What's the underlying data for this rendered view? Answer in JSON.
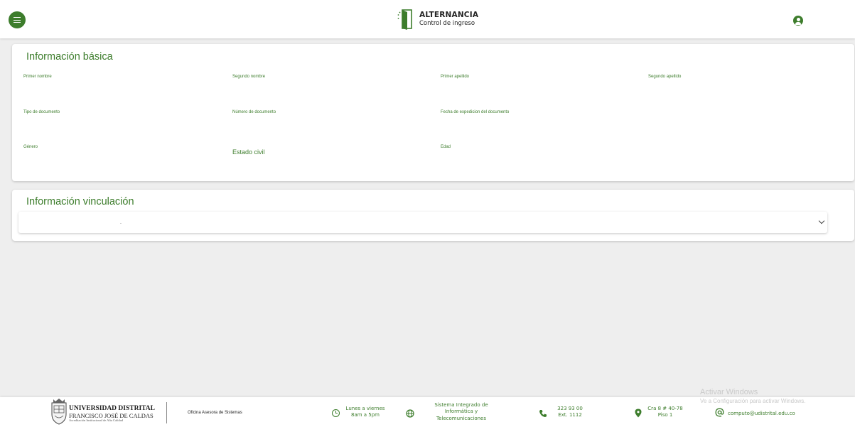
{
  "header": {
    "brand_title": "ALTERNANCIA",
    "brand_subtitle": "Control de ingreso",
    "menu_icon": "hamburger-icon",
    "user_icon": "user-circle-icon"
  },
  "basic_info": {
    "title": "Información básica",
    "fields": {
      "primer_nombre": "Primer nombre",
      "segundo_nombre": "Segundo nombre",
      "primer_apellido": "Primer apellido",
      "segundo_apellido": "Segundo apellido",
      "tipo_documento": "Tipo de documento",
      "numero_documento": "Número de documento",
      "fecha_expedicion": "Fecha de expedicion del documento",
      "genero": "Género",
      "estado_civil": "Estado civil",
      "edad": "Edad"
    }
  },
  "vinculacion": {
    "title": "Información vinculación",
    "panel_text": ".",
    "expand_icon": "chevron-down-icon"
  },
  "footer": {
    "university_line1": "UNIVERSIDAD DISTRITAL",
    "university_line2": "FRANCISCO JOSÉ DE CALDAS",
    "university_line3": "Acreditación Institucional de Alta Calidad",
    "office": "Oficina Asesora de Sistemas",
    "hours_line1": "Lunes a viernes",
    "hours_line2": "8am a 5pm",
    "system_line1": "Sistema Integrado de",
    "system_line2": "Informática y",
    "system_line3": "Telecomunicaciones",
    "phone_line1": "323 93 00",
    "phone_line2": "Ext. 1112",
    "address_line1": "Cra 8 # 40-78",
    "address_line2": "Piso 1",
    "email": "computo@udistrital.edu.co",
    "accent_color": "#3d7d2c"
  },
  "overlay": {
    "activate_title": "Activar Windows",
    "activate_subtitle": "Ve a Configuración para activar Windows."
  }
}
